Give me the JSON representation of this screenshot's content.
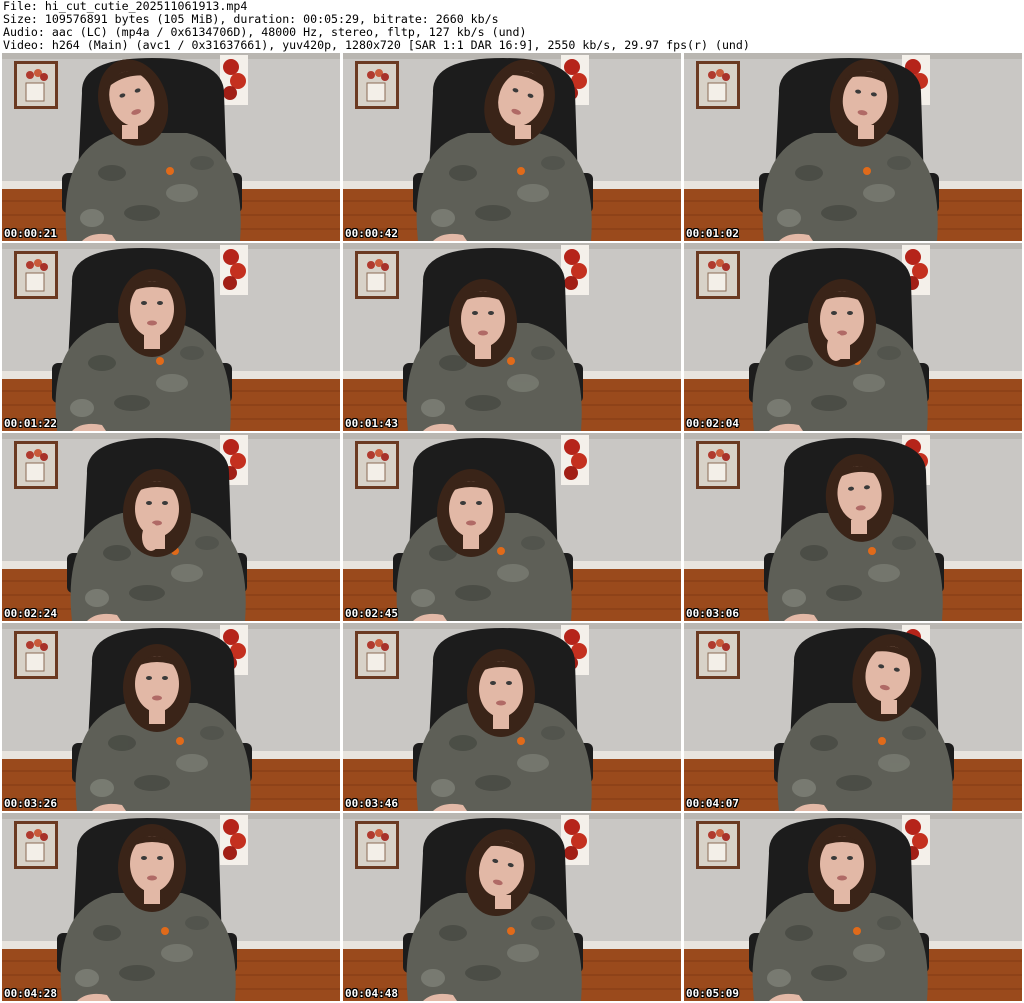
{
  "header": {
    "file": "File: hi_cut_cutie_202511061913.mp4",
    "size": "Size: 109576891 bytes (105 MiB), duration: 00:05:29, bitrate: 2660 kb/s",
    "audio": "Audio: aac (LC) (mp4a / 0x6134706D), 48000 Hz, stereo, fltp, 127 kb/s (und)",
    "video": "Video: h264 (Main) (avc1 / 0x31637661), yuv420p, 1280x720 [SAR 1:1 DAR 16:9], 2550 kb/s, 29.97 fps(r) (und)"
  },
  "thumbnails": [
    {
      "timestamp": "00:00:21"
    },
    {
      "timestamp": "00:00:42"
    },
    {
      "timestamp": "00:01:02"
    },
    {
      "timestamp": "00:01:22"
    },
    {
      "timestamp": "00:01:43"
    },
    {
      "timestamp": "00:02:04"
    },
    {
      "timestamp": "00:02:24"
    },
    {
      "timestamp": "00:02:45"
    },
    {
      "timestamp": "00:03:06"
    },
    {
      "timestamp": "00:03:26"
    },
    {
      "timestamp": "00:03:46"
    },
    {
      "timestamp": "00:04:07"
    },
    {
      "timestamp": "00:04:28"
    },
    {
      "timestamp": "00:04:48"
    },
    {
      "timestamp": "00:05:09"
    }
  ],
  "colors": {
    "wall": "#c9c7c4",
    "floor": "#9a4a1c",
    "chair": "#1c1c1c",
    "camo": "#5e5f57",
    "hair": "#3a2418",
    "skin": "#e2b8a6",
    "accent_orange": "#e06a1a",
    "frame": "#d8d2c8"
  }
}
